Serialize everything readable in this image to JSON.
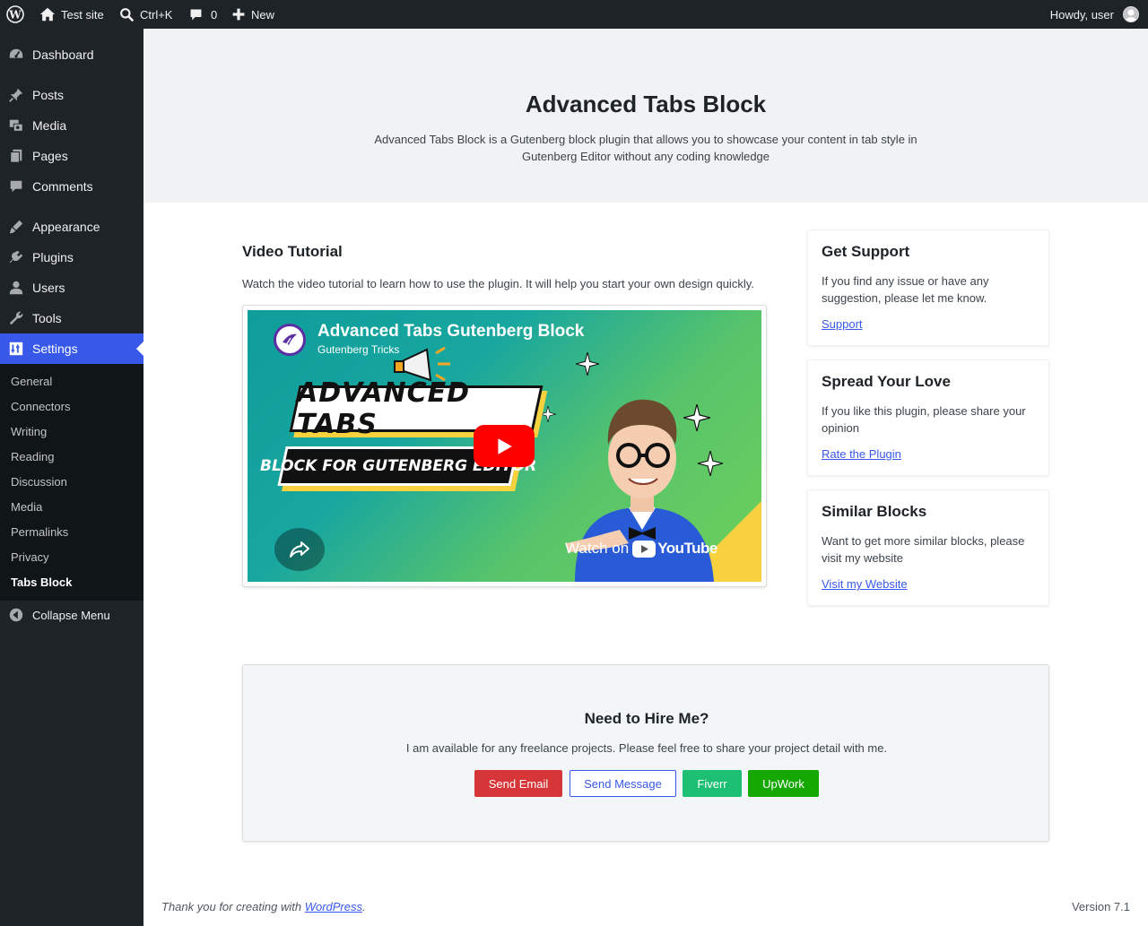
{
  "adminbar": {
    "site_name": "Test site",
    "search_shortcut": "Ctrl+K",
    "comments_count": "0",
    "new_label": "New",
    "greeting": "Howdy, user"
  },
  "sidebar": {
    "items": [
      {
        "label": "Dashboard",
        "icon": "dashboard-icon"
      },
      {
        "label": "Posts",
        "icon": "pin-icon"
      },
      {
        "label": "Media",
        "icon": "media-icon"
      },
      {
        "label": "Pages",
        "icon": "pages-icon"
      },
      {
        "label": "Comments",
        "icon": "comment-icon"
      },
      {
        "label": "Appearance",
        "icon": "brush-icon"
      },
      {
        "label": "Plugins",
        "icon": "plugin-icon"
      },
      {
        "label": "Users",
        "icon": "user-icon"
      },
      {
        "label": "Tools",
        "icon": "wrench-icon"
      },
      {
        "label": "Settings",
        "icon": "settings-icon"
      }
    ],
    "submenu": [
      "General",
      "Connectors",
      "Writing",
      "Reading",
      "Discussion",
      "Media",
      "Permalinks",
      "Privacy",
      "Tabs Block"
    ],
    "collapse_label": "Collapse Menu"
  },
  "hero": {
    "title": "Advanced Tabs Block",
    "description": "Advanced Tabs Block is a Gutenberg block plugin that allows you to showcase your content in tab style in Gutenberg Editor without any coding knowledge"
  },
  "video": {
    "section_title": "Video Tutorial",
    "section_desc": "Watch the video tutorial to learn how to use the plugin. It will help you start your own design quickly.",
    "video_title": "Advanced Tabs Gutenberg Block",
    "channel": "Gutenberg Tricks",
    "thumb_line1": "ADVANCED TABS",
    "thumb_line2": "BLOCK FOR GUTENBERG EDITOR",
    "watch_on": "Watch on",
    "youtube": "YouTube"
  },
  "cards": [
    {
      "title": "Get Support",
      "desc": "If you find any issue or have any suggestion, please let me know.",
      "link": "Support"
    },
    {
      "title": "Spread Your Love",
      "desc": "If you like this plugin, please share your opinion",
      "link": "Rate the Plugin"
    },
    {
      "title": "Similar Blocks",
      "desc": "Want to get more similar blocks, please visit my website",
      "link": "Visit my Website"
    }
  ],
  "hire": {
    "title": "Need to Hire Me?",
    "desc": "I am available for any freelance projects. Please feel free to share your project detail with me.",
    "buttons": {
      "email": "Send Email",
      "message": "Send Message",
      "fiverr": "Fiverr",
      "upwork": "UpWork"
    }
  },
  "footer": {
    "thanks_prefix": "Thank you for creating with ",
    "wordpress": "WordPress",
    "thanks_suffix": ".",
    "version": "Version 7.1"
  },
  "colors": {
    "accent": "#3858e9",
    "adminbar_bg": "#1d2327",
    "email_btn": "#d63638",
    "fiverr_btn": "#1dbf73",
    "upwork_btn": "#14a800",
    "youtube_red": "#ff0000"
  }
}
